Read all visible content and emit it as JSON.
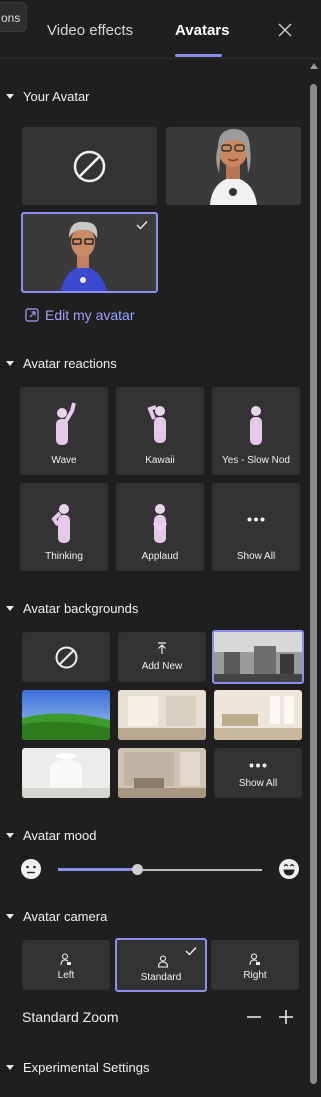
{
  "tabs": {
    "partial": "ons",
    "video_effects": "Video effects",
    "avatars": "Avatars"
  },
  "your_avatar": {
    "heading": "Your Avatar",
    "edit_link": "Edit my avatar"
  },
  "reactions": {
    "heading": "Avatar reactions",
    "items": [
      "Wave",
      "Kawaii",
      "Yes - Slow Nod",
      "Thinking",
      "Applaud",
      "Show All"
    ]
  },
  "backgrounds": {
    "heading": "Avatar backgrounds",
    "add_new": "Add New",
    "show_all": "Show All"
  },
  "mood": {
    "heading": "Avatar mood",
    "level_percent": 39
  },
  "camera": {
    "heading": "Avatar camera",
    "options": [
      "Left",
      "Standard",
      "Right"
    ],
    "selected": "Standard"
  },
  "zoom": {
    "label": "Standard Zoom"
  },
  "experimental": {
    "heading": "Experimental Settings"
  },
  "colors": {
    "accent": "#8b8ff0",
    "tile": "#333333",
    "background": "#1f1f1f"
  }
}
